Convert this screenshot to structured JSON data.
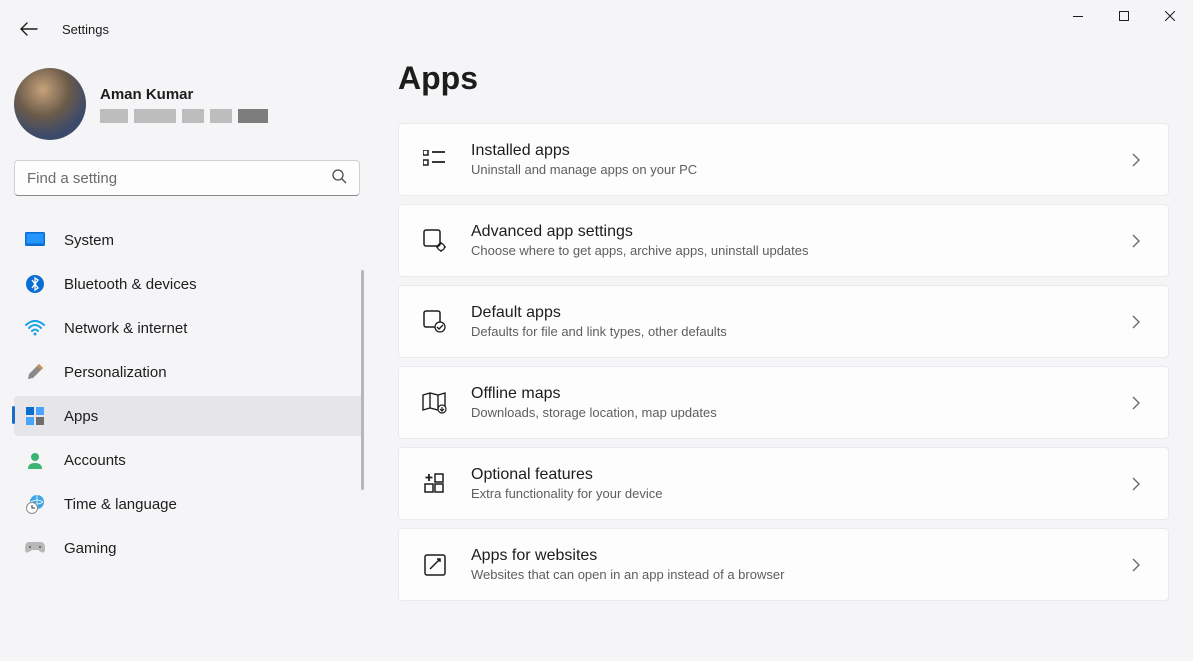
{
  "window": {
    "title": "Settings"
  },
  "user": {
    "name": "Aman Kumar"
  },
  "search": {
    "placeholder": "Find a setting"
  },
  "nav": {
    "items": [
      {
        "key": "system",
        "label": "System"
      },
      {
        "key": "bluetooth",
        "label": "Bluetooth & devices"
      },
      {
        "key": "network",
        "label": "Network & internet"
      },
      {
        "key": "personalization",
        "label": "Personalization"
      },
      {
        "key": "apps",
        "label": "Apps"
      },
      {
        "key": "accounts",
        "label": "Accounts"
      },
      {
        "key": "time",
        "label": "Time & language"
      },
      {
        "key": "gaming",
        "label": "Gaming"
      }
    ],
    "active": "apps"
  },
  "main": {
    "title": "Apps",
    "cards": [
      {
        "title": "Installed apps",
        "sub": "Uninstall and manage apps on your PC"
      },
      {
        "title": "Advanced app settings",
        "sub": "Choose where to get apps, archive apps, uninstall updates"
      },
      {
        "title": "Default apps",
        "sub": "Defaults for file and link types, other defaults"
      },
      {
        "title": "Offline maps",
        "sub": "Downloads, storage location, map updates"
      },
      {
        "title": "Optional features",
        "sub": "Extra functionality for your device"
      },
      {
        "title": "Apps for websites",
        "sub": "Websites that can open in an app instead of a browser"
      }
    ]
  }
}
